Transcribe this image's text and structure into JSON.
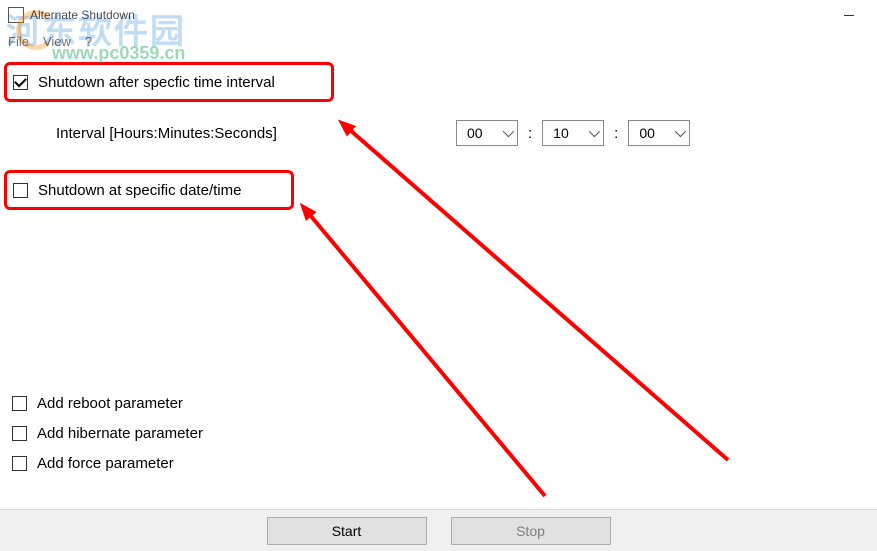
{
  "window": {
    "title": "Alternate Shutdown"
  },
  "menu": {
    "file": "File",
    "view": "View",
    "help": "?"
  },
  "option_interval": {
    "label": "Shutdown after specfic time interval",
    "checked": true
  },
  "option_datetime": {
    "label": "Shutdown at specific date/time",
    "checked": false
  },
  "interval": {
    "label": "Interval [Hours:Minutes:Seconds]",
    "hours": "00",
    "minutes": "10",
    "seconds": "00"
  },
  "params": {
    "reboot": "Add reboot parameter",
    "hibernate": "Add hibernate parameter",
    "force": "Add force parameter"
  },
  "buttons": {
    "start": "Start",
    "stop": "Stop"
  },
  "watermark": {
    "cn": "河东软件园",
    "url": "www.pc0359.cn"
  }
}
